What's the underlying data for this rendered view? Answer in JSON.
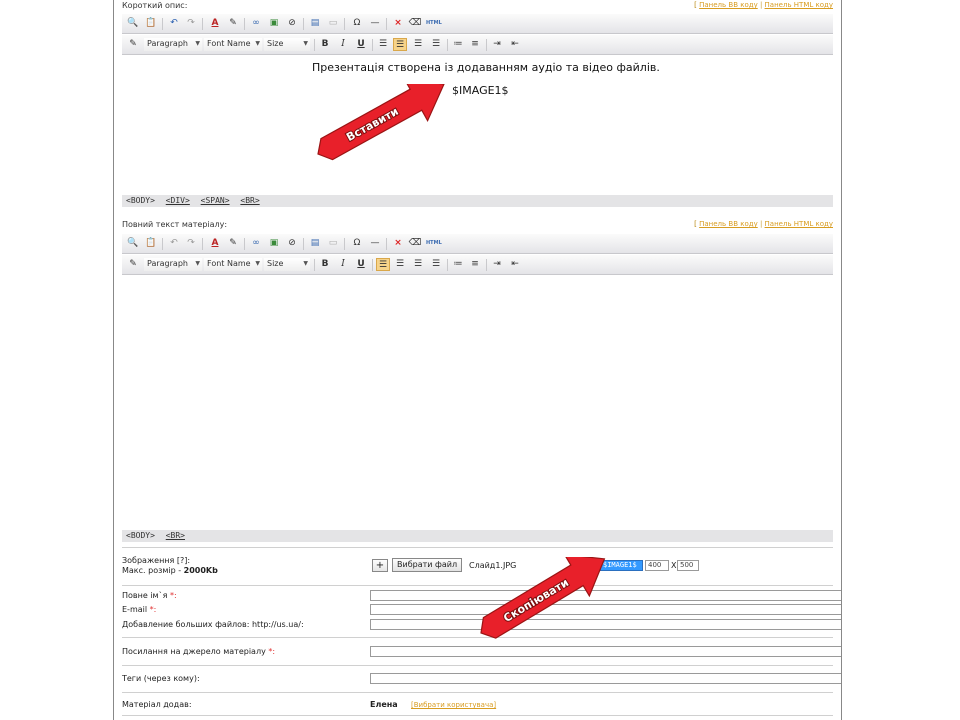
{
  "panel_links": {
    "bb": "Панель BB коду",
    "sep": " | ",
    "html": "Панель HTML коду"
  },
  "short_desc": {
    "label": "Короткий опис:",
    "content_line": "Презентація створена із додаванням аудіо та відео файлів.",
    "placeholder": "$IMAGE1$",
    "status_tags": [
      "<BODY>",
      "<DIV>",
      "<SPAN>",
      "<BR>"
    ]
  },
  "full_text": {
    "label": "Повний текст матеріалу:",
    "status_tags": [
      "<BODY>",
      "<BR>"
    ]
  },
  "toolbar": {
    "paragraph": "Paragraph",
    "font_name": "Font Name",
    "size": "Size",
    "bold": "B",
    "italic": "I",
    "underline": "U",
    "omega": "Ω",
    "hr": "—",
    "html": "HTML"
  },
  "form": {
    "image_label": "Зображення [?]:",
    "image_maxsize_prefix": "Макс. розмір - ",
    "image_maxsize_value": "2000Kb",
    "plus": "+",
    "choose_file": "Вибрати файл",
    "file_name": "Слайд1.JPG",
    "image_tag": "$IMAGE1$",
    "width_value": "400",
    "x": "X",
    "height_value": "500",
    "fullname_label": "Повне ім`я ",
    "email_label": "E-mail ",
    "big_files_label": "Добавление больших файлов: http://us.ua/:",
    "source_label": "Посилання на джерело матеріалу ",
    "tags_label": "Теги (через кому):",
    "added_by_label": "Матеріал додав:",
    "added_by_value": "Елена",
    "choose_user": "[Вибрати користувача]",
    "required": "*:"
  },
  "callouts": {
    "insert": "Вставити",
    "copy": "Скопіювати",
    "fill_color": "#e8202a",
    "stroke_color": "#9a1414"
  }
}
